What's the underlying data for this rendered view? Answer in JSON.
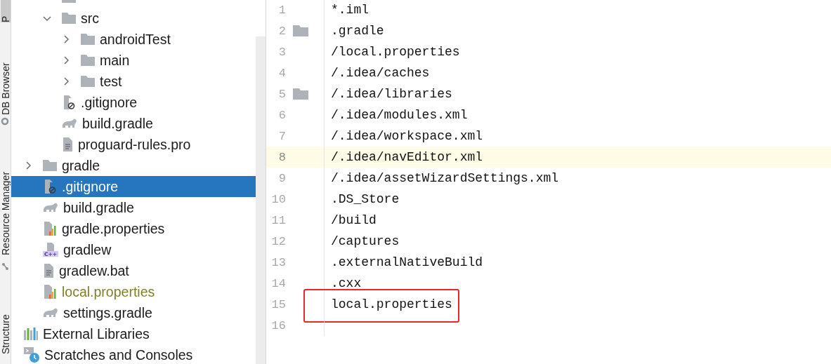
{
  "tool_strip": {
    "tabs": [
      {
        "label": "P",
        "selected": true
      },
      {
        "label": "DB Browser",
        "selected": false
      },
      {
        "label": "Resource Manager",
        "selected": false
      },
      {
        "label": "Structure",
        "selected": false
      }
    ]
  },
  "project_tree": [
    {
      "children": [
        {
          "children": [
            {
              "kind": "folder",
              "selected": false
            },
            {
              "label": "src",
              "kind": "folder",
              "expanded": true,
              "selected": false,
              "ignored": false,
              "children": [
                {
                  "label": "androidTest",
                  "kind": "folder",
                  "expanded": false,
                  "selected": false,
                  "ignored": false
                },
                {
                  "label": "main",
                  "kind": "folder",
                  "expanded": false,
                  "selected": false,
                  "ignored": false
                },
                {
                  "label": "test",
                  "kind": "folder",
                  "expanded": false,
                  "selected": false,
                  "ignored": false
                }
              ]
            },
            {
              "label": ".gitignore",
              "kind": "gitignore",
              "selected": false,
              "ignored": false
            },
            {
              "label": "build.gradle",
              "kind": "gradle",
              "selected": false,
              "ignored": false
            },
            {
              "label": "proguard-rules.pro",
              "kind": "text",
              "selected": false,
              "ignored": false
            }
          ]
        },
        {
          "label": "gradle",
          "kind": "folder",
          "expanded": false,
          "selected": false,
          "ignored": false
        },
        {
          "label": ".gitignore",
          "kind": "gitignore",
          "selected": true,
          "ignored": false
        },
        {
          "label": "build.gradle",
          "kind": "gradle",
          "selected": false,
          "ignored": false
        },
        {
          "label": "gradle.properties",
          "kind": "properties",
          "selected": false,
          "ignored": false
        },
        {
          "label": "gradlew",
          "kind": "shell",
          "badge": "C++",
          "selected": false,
          "ignored": false
        },
        {
          "label": "gradlew.bat",
          "kind": "text",
          "selected": false,
          "ignored": false
        },
        {
          "label": "local.properties",
          "kind": "properties",
          "selected": false,
          "ignored": true
        },
        {
          "label": "settings.gradle",
          "kind": "gradle",
          "selected": false,
          "ignored": false
        }
      ]
    },
    {
      "label": "External Libraries",
      "kind": "libraries",
      "selected": false,
      "ignored": false
    },
    {
      "label": "Scratches and Consoles",
      "kind": "scratches",
      "selected": false,
      "ignored": false
    }
  ],
  "editor": {
    "lines": [
      {
        "number": "1",
        "text": "*.iml",
        "gutter_folder": false,
        "current": false,
        "boxed": false
      },
      {
        "number": "2",
        "text": ".gradle",
        "gutter_folder": true,
        "current": false,
        "boxed": false
      },
      {
        "number": "3",
        "text": "/local.properties",
        "gutter_folder": false,
        "current": false,
        "boxed": false
      },
      {
        "number": "4",
        "text": "/.idea/caches",
        "gutter_folder": false,
        "current": false,
        "boxed": false
      },
      {
        "number": "5",
        "text": "/.idea/libraries",
        "gutter_folder": true,
        "current": false,
        "boxed": false
      },
      {
        "number": "6",
        "text": "/.idea/modules.xml",
        "gutter_folder": false,
        "current": false,
        "boxed": false
      },
      {
        "number": "7",
        "text": "/.idea/workspace.xml",
        "gutter_folder": false,
        "current": false,
        "boxed": false
      },
      {
        "number": "8",
        "text": "/.idea/navEditor.xml",
        "gutter_folder": false,
        "current": true,
        "boxed": false
      },
      {
        "number": "9",
        "text": "/.idea/assetWizardSettings.xml",
        "gutter_folder": false,
        "current": false,
        "boxed": false
      },
      {
        "number": "10",
        "text": ".DS_Store",
        "gutter_folder": false,
        "current": false,
        "boxed": false
      },
      {
        "number": "11",
        "text": "/build",
        "gutter_folder": false,
        "current": false,
        "boxed": false
      },
      {
        "number": "12",
        "text": "/captures",
        "gutter_folder": false,
        "current": false,
        "boxed": false
      },
      {
        "number": "13",
        "text": ".externalNativeBuild",
        "gutter_folder": false,
        "current": false,
        "boxed": false
      },
      {
        "number": "14",
        "text": ".cxx",
        "gutter_folder": false,
        "current": false,
        "boxed": false
      },
      {
        "number": "15",
        "text": "local.properties",
        "gutter_folder": false,
        "current": false,
        "boxed": true
      },
      {
        "number": "16",
        "gutter_folder": false,
        "current": false,
        "boxed": false
      }
    ]
  }
}
